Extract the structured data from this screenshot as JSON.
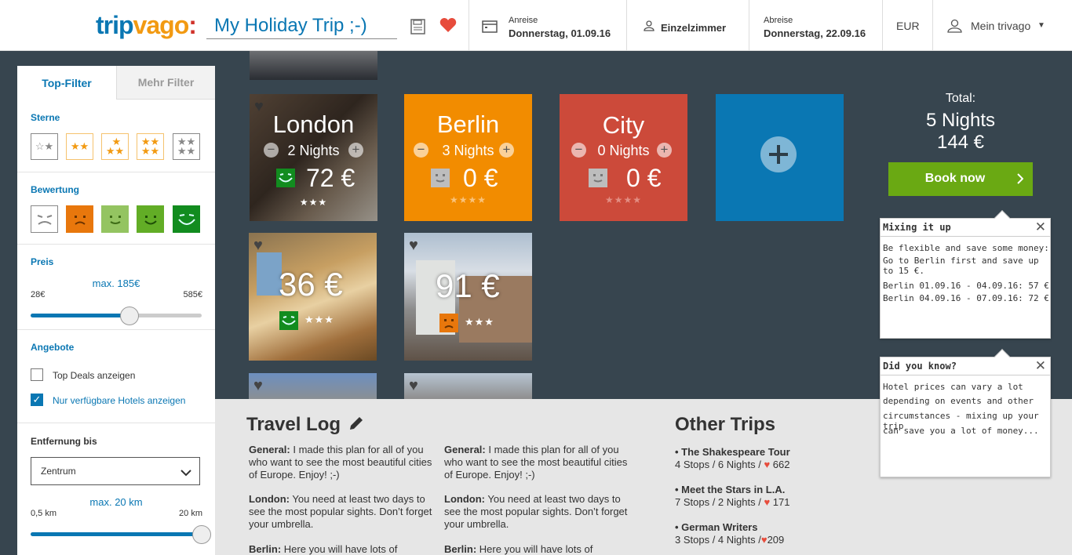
{
  "header": {
    "logo": {
      "part1": "trip",
      "part2": "vago",
      "part3": ":"
    },
    "trip_name": "My Holiday Trip ;-)",
    "checkin_label": "Anreise",
    "checkin_value": "Donnerstag, 01.09.16",
    "room": "Einzelzimmer",
    "checkout_label": "Abreise",
    "checkout_value": "Donnerstag, 22.09.16",
    "currency": "EUR",
    "account": "Mein trivago"
  },
  "sidebar": {
    "tab_top": "Top-Filter",
    "tab_more": "Mehr Filter",
    "stars_title": "Sterne",
    "rating_title": "Bewertung",
    "price_title": "Preis",
    "price_max": "max. 185€",
    "price_min_label": "28€",
    "price_max_label": "585€",
    "price_value": 0.58,
    "offers_title": "Angebote",
    "offer_top_deals": "Top Deals anzeigen",
    "offer_available": "Nur verfügbare Hotels anzeigen",
    "distance_title": "Entfernung bis",
    "distance_select": "Zentrum",
    "distance_max": "max. 20 km",
    "distance_min_label": "0,5 km",
    "distance_max_label": "20 km",
    "distance_value": 1.0
  },
  "tiles": [
    {
      "city": "London",
      "nights": "2 Nights",
      "price": "72 €",
      "stars": "★★★"
    },
    {
      "city": "Berlin",
      "nights": "3 Nights",
      "price": "0 €",
      "stars": "★★★★"
    },
    {
      "city": "City",
      "nights": "0 Nights",
      "price": "0 €",
      "stars": "★★★★"
    }
  ],
  "hotels": [
    {
      "price": "36 €",
      "stars": "★★★"
    },
    {
      "price": "91 €",
      "stars": "★★★"
    }
  ],
  "summary": {
    "total_label": "Total:",
    "nights": "5 Nights",
    "price": "144 €",
    "book_label": "Book now"
  },
  "popup_mixing": {
    "title": "Mixing it up",
    "line1": "Be flexible and save some money:",
    "line2": "Go to Berlin first and save up to 15 €.",
    "line3": "Berlin 01.09.16 - 04.09.16: 57 €",
    "line4": "Berlin 04.09.16 - 07.09.16: 72 €"
  },
  "popup_didyouknow": {
    "title": "Did you know?",
    "line1": "Hotel prices can vary a lot",
    "line2": "depending on events and other",
    "line3": "circumstances - mixing up your trip",
    "line4": "can save you a lot of money..."
  },
  "travel_log": {
    "title": "Travel Log",
    "col1": {
      "general_label": "General:",
      "general_text": "I made this plan for all of you who want to see the most beautiful cities of Europe. Enjoy! ;-)",
      "london_label": "London:",
      "london_text": "You need at least two days to see the most popular sights. Don’t forget your umbrella.",
      "berlin_label": "Berlin:",
      "berlin_text": "Here you will have lots of"
    },
    "col2": {
      "general_label": "General:",
      "general_text": "I made this plan for all of you who want to see the most beautiful cities of Europe. Enjoy! ;-)",
      "london_label": "London:",
      "london_text": "You need at least two days to see the most popular sights. Don’t forget your umbrella.",
      "berlin_label": "Berlin:",
      "berlin_text": "Here you will have lots of"
    }
  },
  "other_trips": {
    "title": "Other Trips",
    "trips": [
      {
        "name": "• The Shakespeare Tour",
        "stops": "4 Stops / 6 Nights / ",
        "likes": "662"
      },
      {
        "name": "• Meet the Stars in L.A.",
        "stops": "7 Stops / 2 Nights / ",
        "likes": "171"
      },
      {
        "name": "• German Writers",
        "stops": "3 Stops / 4 Nights /",
        "likes": "209"
      }
    ]
  },
  "colors": {
    "brand_blue": "#0a77b3",
    "london_bg": "#5a4a3e",
    "berlin_bg": "#f28c00",
    "city_bg": "#cc4a3a",
    "add_bg": "#0a77b3",
    "book_green": "#6aa913",
    "page_bg": "#37454f"
  }
}
